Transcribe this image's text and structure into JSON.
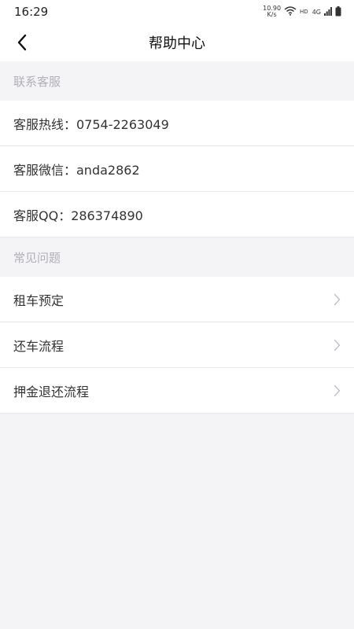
{
  "status_bar": {
    "time": "16:29",
    "net_speed_value": "10.90",
    "net_speed_unit": "K/s",
    "hd_label": "HD",
    "network_label": "4G"
  },
  "header": {
    "title": "帮助中心"
  },
  "contact_section": {
    "title": "联系客服",
    "items": [
      {
        "label": "客服热线：0754-2263049"
      },
      {
        "label": "客服微信：anda2862"
      },
      {
        "label": "客服QQ：286374890"
      }
    ]
  },
  "faq_section": {
    "title": "常见问题",
    "items": [
      {
        "label": "租车预定"
      },
      {
        "label": "还车流程"
      },
      {
        "label": "押金退还流程"
      }
    ]
  },
  "icons": {
    "back": "back-arrow-icon",
    "chevron": "chevron-right-icon",
    "wifi": "wifi-icon",
    "signal": "signal-icon",
    "battery": "battery-icon"
  }
}
